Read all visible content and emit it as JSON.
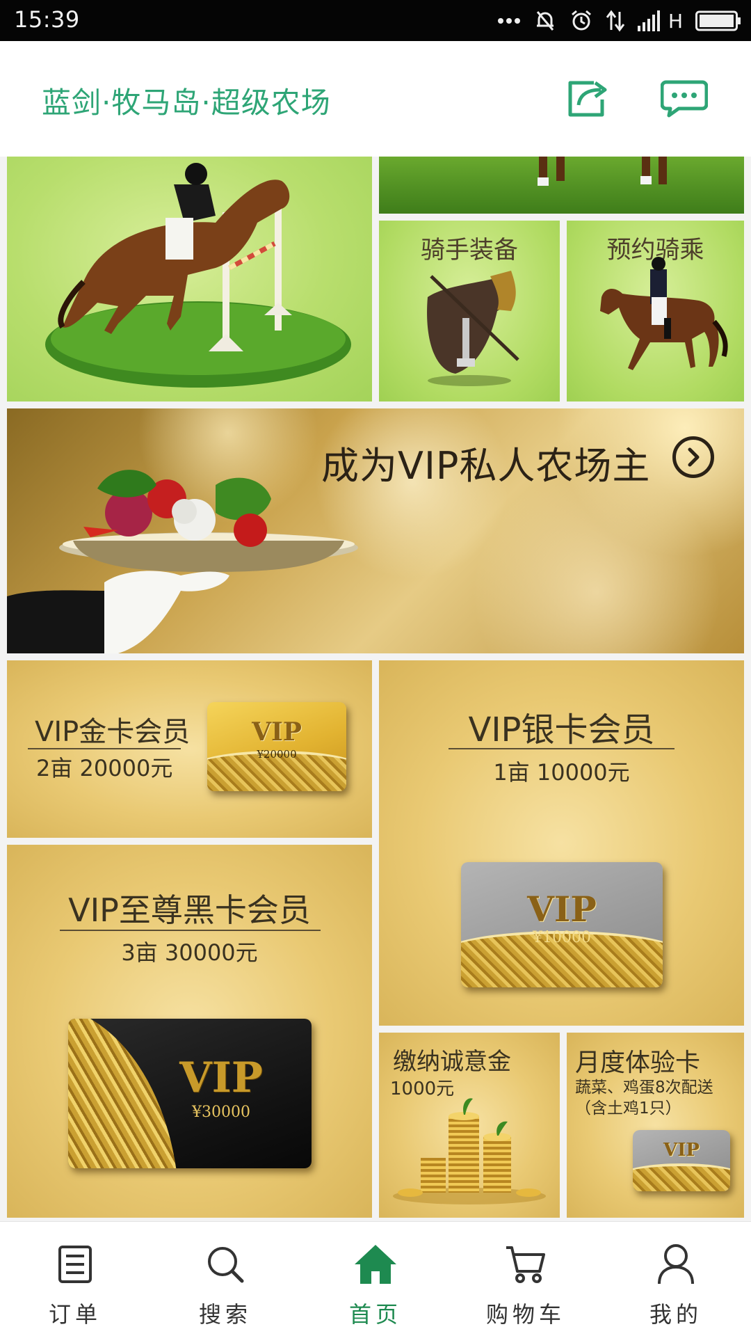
{
  "status_bar": {
    "time": "15:39",
    "network": "H"
  },
  "header": {
    "title": "蓝剑·牧马岛·超级农场"
  },
  "tiles": {
    "rider_gear": "骑手装备",
    "book_ride": "预约骑乘"
  },
  "banner": {
    "text": "成为VIP私人农场主"
  },
  "gold_member": {
    "name": "VIP金卡会员",
    "price": "2亩   20000元",
    "card_label": "VIP",
    "card_amount": "¥20000"
  },
  "silver_member": {
    "name": "VIP银卡会员",
    "price": "1亩   10000元",
    "card_label": "VIP",
    "card_amount": "¥10000"
  },
  "black_member": {
    "name": "VIP至尊黑卡会员",
    "price": "3亩   30000元",
    "card_label": "VIP",
    "card_amount": "¥30000"
  },
  "deposit": {
    "title": "缴纳诚意金",
    "amount": "1000元"
  },
  "monthly": {
    "title": "月度体验卡",
    "desc_line1": "蔬菜、鸡蛋8次配送",
    "desc_line2": "（含土鸡1只）",
    "card_label": "VIP"
  },
  "nav": {
    "items": [
      {
        "label": "订单"
      },
      {
        "label": "搜索"
      },
      {
        "label": "首页"
      },
      {
        "label": "购物车"
      },
      {
        "label": "我的"
      }
    ]
  },
  "colors": {
    "brand_green": "#2ea576",
    "nav_active": "#1e8a50",
    "gold": "#e9c973"
  }
}
